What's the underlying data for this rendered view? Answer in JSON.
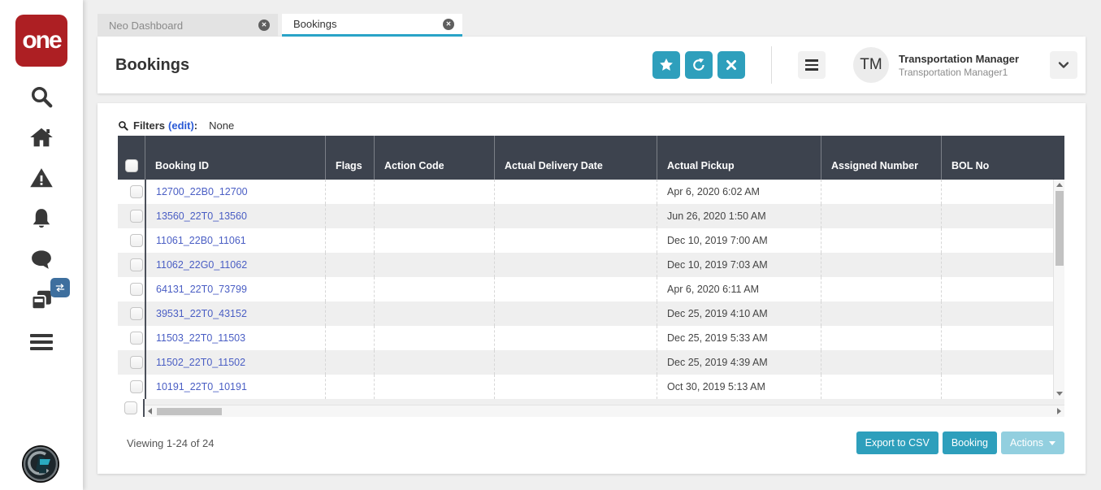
{
  "sidebar": {
    "logo": "one",
    "icons": [
      "search-icon",
      "home-icon",
      "alerts-icon",
      "notifications-icon",
      "messages-icon",
      "workspaces-icon",
      "swap-icon",
      "menu-icon",
      "assistant-avatar"
    ]
  },
  "icon_glyphs": {
    "close": "✕",
    "caret_down": "▾"
  },
  "tabs": [
    {
      "label": "Neo Dashboard",
      "active": false
    },
    {
      "label": "Bookings",
      "active": true
    }
  ],
  "header": {
    "title": "Bookings",
    "action_icons": [
      "favorite-star-icon",
      "refresh-icon",
      "close-icon"
    ],
    "user": {
      "initials": "TM",
      "name": "Transportation Manager",
      "role": "Transportation Manager1"
    }
  },
  "filters": {
    "label": "Filters",
    "edit": "(edit)",
    "colon": ":",
    "value": "None"
  },
  "table": {
    "columns": [
      "Booking ID",
      "Flags",
      "Action Code",
      "Actual Delivery Date",
      "Actual Pickup",
      "Assigned Number",
      "BOL No"
    ],
    "rows": [
      {
        "booking_id": "12700_22B0_12700",
        "flags": "",
        "action_code": "",
        "actual_delivery_date": "",
        "actual_pickup": "Apr 6, 2020 6:02 AM",
        "assigned_number": "",
        "bol_no": ""
      },
      {
        "booking_id": "13560_22T0_13560",
        "flags": "",
        "action_code": "",
        "actual_delivery_date": "",
        "actual_pickup": "Jun 26, 2020 1:50 AM",
        "assigned_number": "",
        "bol_no": ""
      },
      {
        "booking_id": "11061_22B0_11061",
        "flags": "",
        "action_code": "",
        "actual_delivery_date": "",
        "actual_pickup": "Dec 10, 2019 7:00 AM",
        "assigned_number": "",
        "bol_no": ""
      },
      {
        "booking_id": "11062_22G0_11062",
        "flags": "",
        "action_code": "",
        "actual_delivery_date": "",
        "actual_pickup": "Dec 10, 2019 7:03 AM",
        "assigned_number": "",
        "bol_no": ""
      },
      {
        "booking_id": "64131_22T0_73799",
        "flags": "",
        "action_code": "",
        "actual_delivery_date": "",
        "actual_pickup": "Apr 6, 2020 6:11 AM",
        "assigned_number": "",
        "bol_no": ""
      },
      {
        "booking_id": "39531_22T0_43152",
        "flags": "",
        "action_code": "",
        "actual_delivery_date": "",
        "actual_pickup": "Dec 25, 2019 4:10 AM",
        "assigned_number": "",
        "bol_no": ""
      },
      {
        "booking_id": "11503_22T0_11503",
        "flags": "",
        "action_code": "",
        "actual_delivery_date": "",
        "actual_pickup": "Dec 25, 2019 5:33 AM",
        "assigned_number": "",
        "bol_no": ""
      },
      {
        "booking_id": "11502_22T0_11502",
        "flags": "",
        "action_code": "",
        "actual_delivery_date": "",
        "actual_pickup": "Dec 25, 2019 4:39 AM",
        "assigned_number": "",
        "bol_no": ""
      },
      {
        "booking_id": "10191_22T0_10191",
        "flags": "",
        "action_code": "",
        "actual_delivery_date": "",
        "actual_pickup": "Oct 30, 2019 5:13 AM",
        "assigned_number": "",
        "bol_no": ""
      }
    ]
  },
  "footer": {
    "viewing": "Viewing 1-24 of 24",
    "buttons": [
      {
        "label": "Export to CSV",
        "disabled": false
      },
      {
        "label": "Booking",
        "disabled": false
      },
      {
        "label": "Actions",
        "disabled": true,
        "has_caret": true
      }
    ]
  },
  "colors": {
    "brand_red": "#AD1F23",
    "accent_teal": "#2E9FBC",
    "tab_underline": "#29A3C7",
    "table_header_bg": "#3D434E",
    "link_blue": "#4A5EC4",
    "disabled_teal": "#92CFDF",
    "row_alt": "#EFEFEF"
  }
}
